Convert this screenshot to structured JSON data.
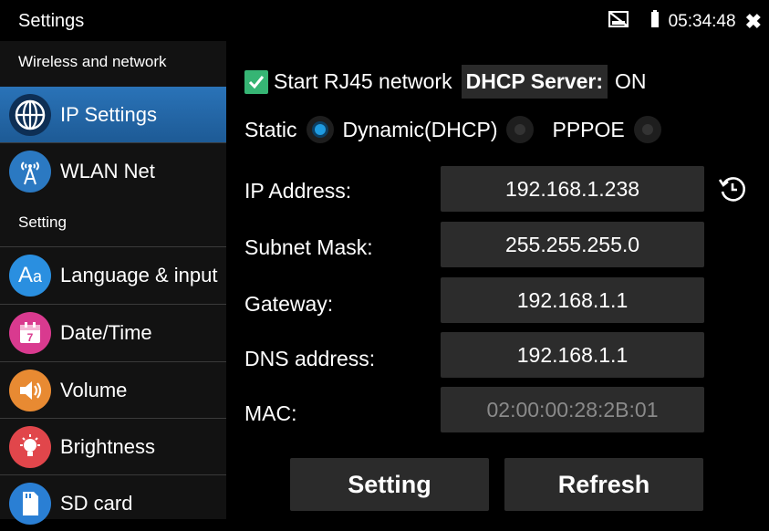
{
  "status": {
    "title": "Settings",
    "time": "05:34:48"
  },
  "sidebar": {
    "sections": [
      {
        "label": "Wireless and network"
      },
      {
        "label": "Setting"
      }
    ],
    "items": [
      {
        "label": "IP Settings",
        "icon": "globe-icon"
      },
      {
        "label": "WLAN Net",
        "icon": "wifi-antenna-icon"
      },
      {
        "label": "Language & input",
        "icon": "language-icon"
      },
      {
        "label": "Date/Time",
        "icon": "calendar-icon"
      },
      {
        "label": "Volume",
        "icon": "speaker-icon"
      },
      {
        "label": "Brightness",
        "icon": "bulb-icon"
      },
      {
        "label": "SD card",
        "icon": "sd-card-icon"
      }
    ]
  },
  "main": {
    "start_rj45_label": "Start RJ45 network",
    "dhcp_server_label": "DHCP Server:",
    "dhcp_server_value": "ON",
    "modes": [
      {
        "label": "Static",
        "selected": true
      },
      {
        "label": "Dynamic(DHCP)",
        "selected": false
      },
      {
        "label": "PPPOE",
        "selected": false
      }
    ],
    "fields": [
      {
        "label": "IP Address:",
        "value": "192.168.1.238"
      },
      {
        "label": "Subnet Mask:",
        "value": "255.255.255.0"
      },
      {
        "label": "Gateway:",
        "value": "192.168.1.1"
      },
      {
        "label": "DNS address:",
        "value": "192.168.1.1"
      },
      {
        "label": "MAC:",
        "value": "02:00:00:28:2B:01"
      }
    ],
    "buttons": {
      "setting": "Setting",
      "refresh": "Refresh"
    }
  },
  "colors": {
    "accent": "#1f9be0",
    "active": "#2a73b8",
    "check": "#36b574"
  }
}
